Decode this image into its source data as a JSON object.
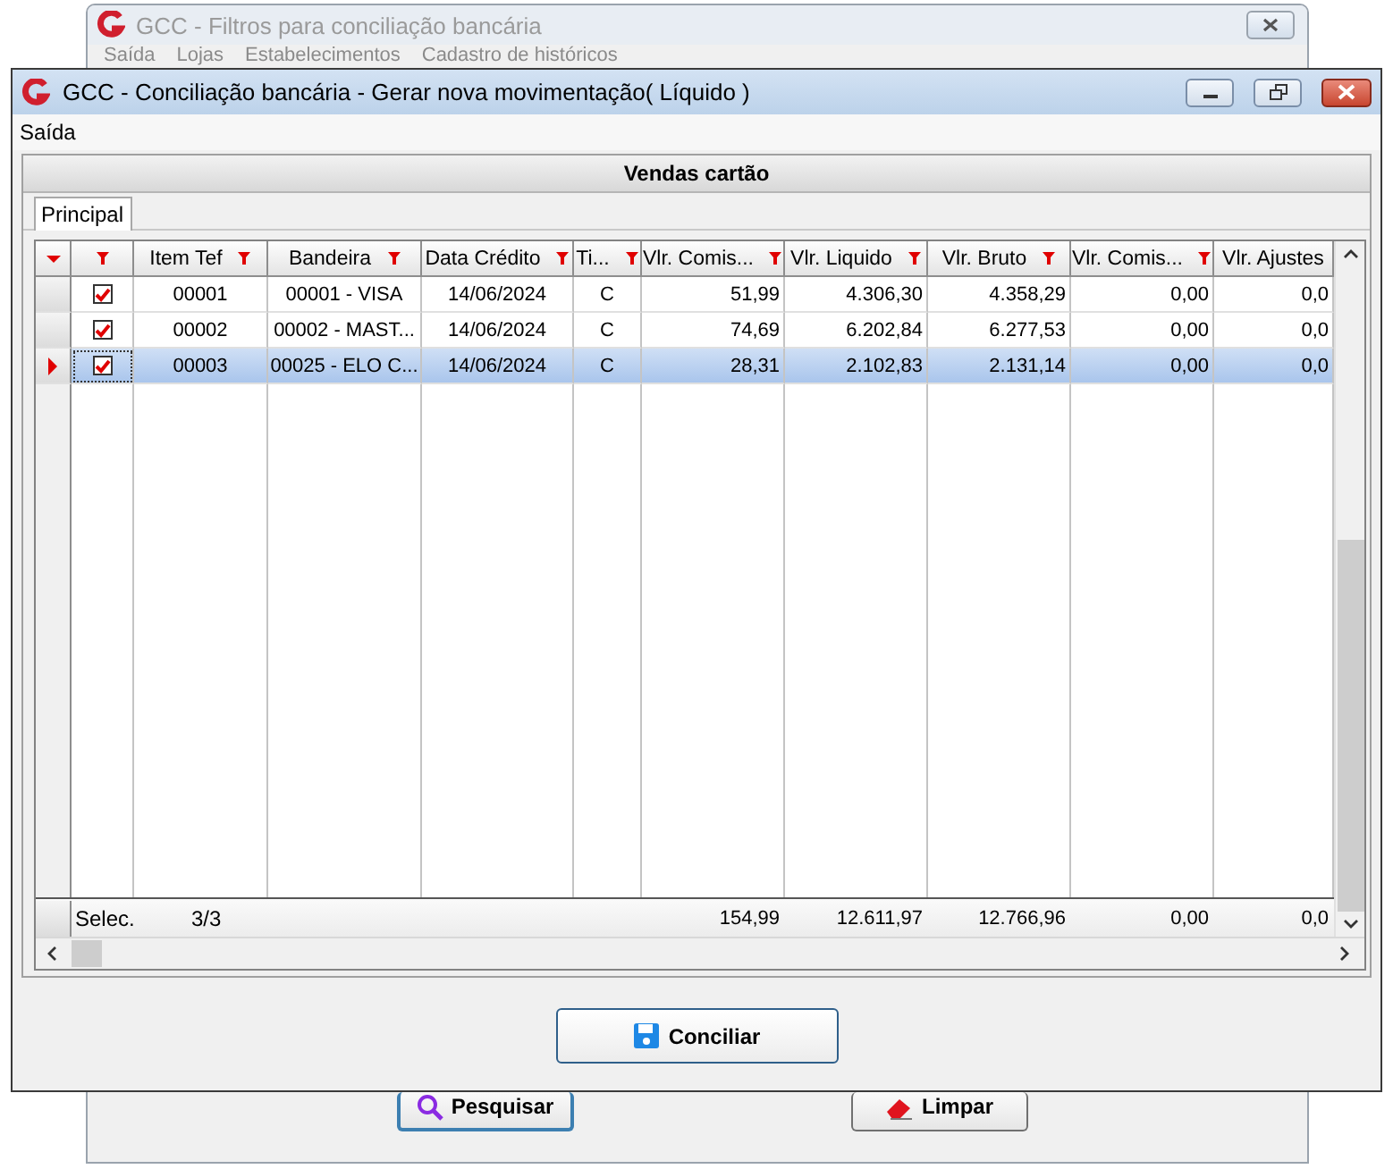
{
  "background_window": {
    "title": "GCC - Filtros para conciliação bancária",
    "menu": [
      "Saída",
      "Lojas",
      "Estabelecimentos",
      "Cadastro de históricos"
    ],
    "buttons": [
      {
        "label": "Pesquisar",
        "kind": "search",
        "focused": true
      },
      {
        "label": "Limpar",
        "kind": "eraser",
        "focused": false
      }
    ]
  },
  "window": {
    "title": "GCC - Conciliação bancária - Gerar nova movimentação( Líquido )",
    "menu": [
      "Saída"
    ],
    "panel_title": "Vendas cartão",
    "tabs": [
      {
        "label": "Principal",
        "selected": true
      }
    ],
    "table": {
      "columns": [
        {
          "label": "Item Tef",
          "kind": "text"
        },
        {
          "label": "Bandeira",
          "kind": "text"
        },
        {
          "label": "Data Crédito",
          "kind": "text"
        },
        {
          "label": "Ti...",
          "kind": "text"
        },
        {
          "label": "Vlr. Comis...",
          "kind": "amount"
        },
        {
          "label": "Vlr. Liquido",
          "kind": "amount"
        },
        {
          "label": "Vlr. Bruto",
          "kind": "amount"
        },
        {
          "label": "Vlr. Comis...",
          "kind": "amount"
        },
        {
          "label": "Vlr. Ajustes",
          "kind": "amount"
        }
      ],
      "rows": [
        {
          "current": false,
          "selected": false,
          "checked": true,
          "cells": [
            "00001",
            "00001 - VISA",
            "14/06/2024",
            "C",
            "51,99",
            "4.306,30",
            "4.358,29",
            "0,00",
            "0,0"
          ]
        },
        {
          "current": false,
          "selected": false,
          "checked": true,
          "cells": [
            "00002",
            "00002 - MAST...",
            "14/06/2024",
            "C",
            "74,69",
            "6.202,84",
            "6.277,53",
            "0,00",
            "0,0"
          ]
        },
        {
          "current": true,
          "selected": true,
          "checked": true,
          "cells": [
            "00003",
            "00025 - ELO C...",
            "14/06/2024",
            "C",
            "28,31",
            "2.102,83",
            "2.131,14",
            "0,00",
            "0,0"
          ]
        }
      ],
      "footer": {
        "label": "Selec.",
        "count": "3/3",
        "totals": [
          "154,99",
          "12.611,97",
          "12.766,96",
          "0,00",
          "0,0"
        ]
      }
    },
    "buttons": [
      {
        "label": "Conciliar",
        "kind": "save"
      }
    ]
  }
}
